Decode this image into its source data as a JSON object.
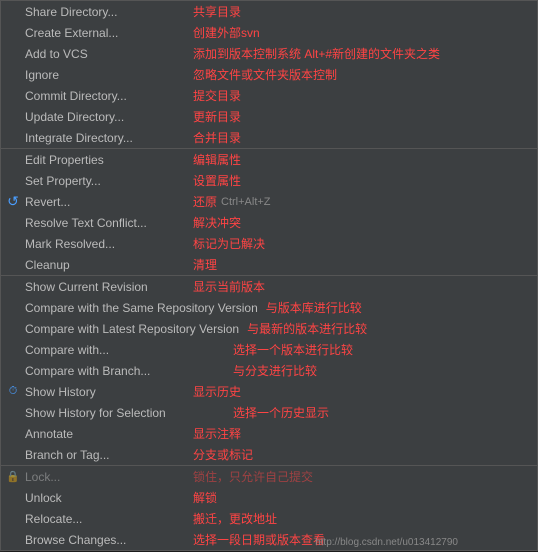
{
  "menu": {
    "items": [
      {
        "id": "share-directory",
        "label": "Share Directory...",
        "annotation": "共享目录",
        "shortcut": "",
        "disabled": false,
        "separator_after": false
      },
      {
        "id": "create-external",
        "label": "Create External...",
        "annotation": "创建外部svn",
        "shortcut": "",
        "disabled": false,
        "separator_after": false
      },
      {
        "id": "add-to-vcs",
        "label": "Add to VCS",
        "annotation": "添加到版本控制系统 Alt+#新创建的文件夹之类",
        "shortcut": "",
        "disabled": false,
        "separator_after": false
      },
      {
        "id": "ignore",
        "label": "Ignore",
        "annotation": "忽略文件或文件夹版本控制",
        "shortcut": "",
        "disabled": false,
        "separator_after": false
      },
      {
        "id": "commit-directory",
        "label": "Commit Directory...",
        "annotation": "提交目录",
        "shortcut": "",
        "disabled": false,
        "separator_after": false
      },
      {
        "id": "update-directory",
        "label": "Update Directory...",
        "annotation": "更新目录",
        "shortcut": "",
        "disabled": false,
        "separator_after": false
      },
      {
        "id": "integrate-directory",
        "label": "Integrate Directory...",
        "annotation": "合并目录",
        "shortcut": "",
        "disabled": false,
        "separator_after": true
      },
      {
        "id": "edit-properties",
        "label": "Edit Properties",
        "annotation": "编辑属性",
        "shortcut": "",
        "disabled": false,
        "separator_after": false
      },
      {
        "id": "set-property",
        "label": "Set Property...",
        "annotation": "设置属性",
        "shortcut": "",
        "disabled": false,
        "separator_after": false
      },
      {
        "id": "revert",
        "label": "Revert...",
        "annotation": "还原",
        "shortcut": "Ctrl+Alt+Z",
        "disabled": false,
        "separator_after": false,
        "has_icon": "revert"
      },
      {
        "id": "resolve-text-conflict",
        "label": "Resolve Text Conflict...",
        "annotation": "解决冲突",
        "shortcut": "",
        "disabled": false,
        "separator_after": false
      },
      {
        "id": "mark-resolved",
        "label": "Mark Resolved...",
        "annotation": "标记为已解决",
        "shortcut": "",
        "disabled": false,
        "separator_after": false
      },
      {
        "id": "cleanup",
        "label": "Cleanup",
        "annotation": "清理",
        "shortcut": "",
        "disabled": false,
        "separator_after": true
      },
      {
        "id": "show-current-revision",
        "label": "Show Current Revision",
        "annotation": "显示当前版本",
        "shortcut": "",
        "disabled": false,
        "separator_after": false
      },
      {
        "id": "compare-same-repo",
        "label": "Compare with the Same Repository Version",
        "annotation": "与版本库进行比较",
        "shortcut": "",
        "disabled": false,
        "separator_after": false,
        "annotation_offset": true
      },
      {
        "id": "compare-latest-repo",
        "label": "Compare with Latest Repository Version",
        "annotation": "与最新的版本进行比较",
        "shortcut": "",
        "disabled": false,
        "separator_after": false,
        "annotation_offset": true
      },
      {
        "id": "compare-with",
        "label": "Compare with...",
        "annotation": "选择一个版本进行比较",
        "shortcut": "",
        "disabled": false,
        "separator_after": false,
        "annotation_offset": true
      },
      {
        "id": "compare-with-branch",
        "label": "Compare with Branch...",
        "annotation": "与分支进行比较",
        "shortcut": "",
        "disabled": false,
        "separator_after": false,
        "annotation_offset": true
      },
      {
        "id": "show-history",
        "label": "Show History",
        "annotation": "显示历史",
        "shortcut": "",
        "disabled": false,
        "separator_after": false,
        "has_icon": "history"
      },
      {
        "id": "show-history-selection",
        "label": "Show History for Selection",
        "annotation": "选择一个历史显示",
        "shortcut": "",
        "disabled": false,
        "separator_after": false,
        "annotation_offset": true
      },
      {
        "id": "annotate",
        "label": "Annotate",
        "annotation": "显示注释",
        "shortcut": "",
        "disabled": false,
        "separator_after": false
      },
      {
        "id": "branch-or-tag",
        "label": "Branch or Tag...",
        "annotation": "分支或标记",
        "shortcut": "",
        "disabled": false,
        "separator_after": true
      },
      {
        "id": "lock",
        "label": "Lock...",
        "annotation": "锁住，只允许自己提交",
        "shortcut": "",
        "disabled": false,
        "separator_after": false
      },
      {
        "id": "unlock",
        "label": "Unlock",
        "annotation": "解锁",
        "shortcut": "",
        "disabled": false,
        "separator_after": false
      },
      {
        "id": "relocate",
        "label": "Relocate...",
        "annotation": "搬迁，更改地址",
        "shortcut": "",
        "disabled": false,
        "separator_after": false
      },
      {
        "id": "browse-changes",
        "label": "Browse Changes...",
        "annotation": "选择一段日期或版本查看",
        "shortcut": "",
        "disabled": false,
        "separator_after": false
      }
    ]
  },
  "watermark": "http://blog.csdn.net/u013412790"
}
